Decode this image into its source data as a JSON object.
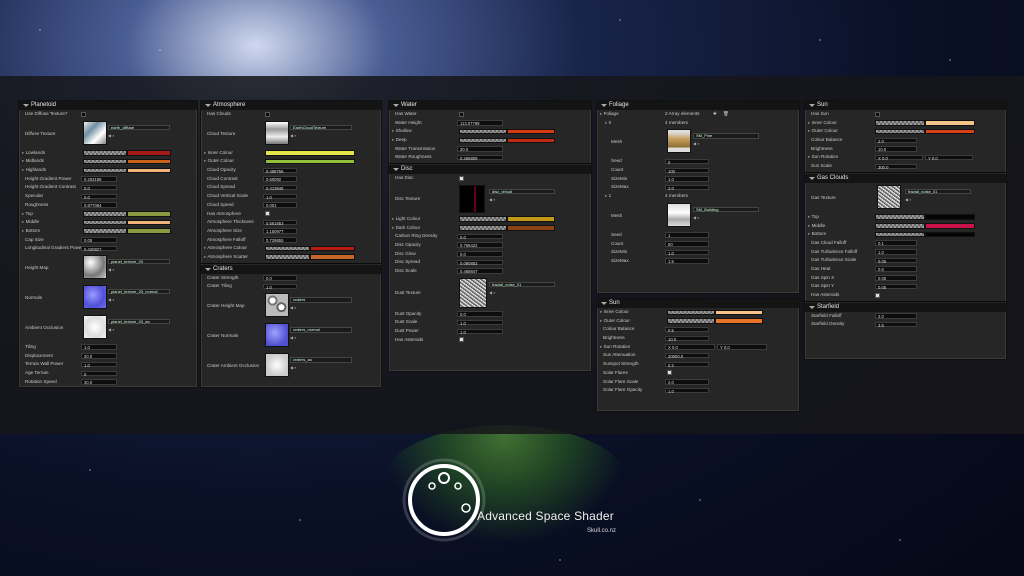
{
  "brand": {
    "title": "Advanced Space Shader",
    "site": "Skull.co.nz"
  },
  "colors": {
    "red": "#a41818",
    "orange": "#c8601a",
    "peach": "#f0b27a",
    "yellow": "#e6e34a",
    "green": "#8fc23a",
    "olive": "#8a9a40",
    "sunpeach": "#f5c28a",
    "sunorange": "#e8742a",
    "magenta": "#c8104a",
    "black": "#050505",
    "darkorange": "#c4682a",
    "darkred": "#b81c10",
    "gold": "#c29a18",
    "brown": "#8a4414",
    "bronze": "#b88a2a"
  },
  "planetoid": {
    "title": "Planetoid",
    "has_diffuse": "Use Diffuse Texture?",
    "diffuse_label": "Diffuse Texture",
    "diffuse_asset": "earth_diffuse",
    "lowlands": "Lowlands",
    "midlands": "Midlands",
    "highlands": "Highlands",
    "hg_power": "Height Gradient Power",
    "hg_power_v": "0.263186",
    "hg_contrast": "Height Gradient Contrast",
    "hg_contrast_v": "0.0",
    "specular": "Specular",
    "specular_v": "0.0",
    "roughness": "Roughness",
    "roughness_v": "0.877064",
    "top": "Top",
    "middle": "Middle",
    "bottom": "Bottom",
    "cap_size": "Cap Size",
    "cap_size_v": "0.05",
    "long_power": "Longitudinal Gradient Power",
    "long_power_v": "0.420827",
    "height_map": "Height Map",
    "height_asset": "planet_texture_03",
    "normals": "Normals",
    "normals_asset": "planet_texture_03_normal",
    "ao": "Ambient Occlusion",
    "ao_asset": "planet_texture_03_ao",
    "tiling": "Tiling",
    "tiling_v": "1.0",
    "displacement": "Displacement",
    "displacement_v": "20.0",
    "terrain_wall": "Terrain Wall Power",
    "terrain_wall_v": "1.0",
    "age_terrain": "Age Terrain",
    "age_terrain_v": "0",
    "rotation": "Rotation Speed",
    "rotation_v": "30.0"
  },
  "atmosphere": {
    "title": "Atmosphere",
    "has_clouds": "Has Clouds",
    "cloud_tex": "Cloud Texture",
    "cloud_asset": "EarthCloudTexture",
    "inner": "Inner Colour",
    "outer": "Outer Colour",
    "c_opacity": "Cloud Opacity",
    "c_opacity_v": "0.498756",
    "c_contrast": "Cloud Contrast",
    "c_contrast_v": "0.60092",
    "c_spread": "Cloud Spread",
    "c_spread_v": "0.413846",
    "c_vscale": "Cloud Vertical Scale",
    "c_vscale_v": "1.0",
    "c_speed": "Cloud Speed",
    "c_speed_v": "0.001",
    "has_atmo": "Has Atmosphere",
    "a_thick": "Atmosphere Thickness",
    "a_thick_v": "0.561653",
    "a_size": "Atmosphere Size",
    "a_size_v": "1.150977",
    "a_falloff": "Atmosphere Falloff",
    "a_falloff_v": "0.729855",
    "a_colour": "Atmosphere Colour",
    "a_scatter": "Atmosphere Scatter"
  },
  "craters": {
    "title": "Craters",
    "strength": "Crater Strength",
    "strength_v": "0.0",
    "tiling": "Crater Tiling",
    "tiling_v": "1.0",
    "height": "Crater Height Map",
    "height_asset": "craters",
    "normals": "Crater Normals",
    "normals_asset": "craters_normal",
    "ao": "Crater Ambient Occlusion",
    "ao_asset": "craters_ao"
  },
  "water": {
    "title": "Water",
    "has_water": "Has Water",
    "height": "Water Height",
    "height_v": "113.07799",
    "shallow": "Shallow",
    "deep": "Deep",
    "trans": "Water Transmission",
    "trans_v": "20.0",
    "rough": "Water Roughness",
    "rough_v": "0.266809"
  },
  "disc": {
    "title": "Disc",
    "has_disc": "Has Disc",
    "tex": "Disc Texture",
    "tex_asset": "disc_virtual",
    "light": "Light Colour",
    "dark": "Dark Colour",
    "carbon": "Carbon Ring Density",
    "carbon_v": "0.0",
    "opacity": "Disc Opacity",
    "opacity_v": "0.756422",
    "glow": "Disc Glow",
    "glow_v": "0.0",
    "spread": "Disc Spread",
    "spread_v": "0.090883",
    "scale": "Disc Scale",
    "scale_v": "0.468847",
    "dust_tex": "Dust Texture",
    "dust_asset": "fractal_noise_01",
    "dust_op": "Dust Opacity",
    "dust_op_v": "0.0",
    "dust_scale": "Dust Scale",
    "dust_scale_v": "1.0",
    "dust_power": "Dust Power",
    "dust_power_v": "1.0",
    "asteroids": "Has Asteroids"
  },
  "foliage": {
    "title": "Foliage",
    "foliage": "Foliage",
    "count_v": "2 Array elements",
    "e0": "0",
    "e1": "1",
    "members": "4 members",
    "mesh": "Mesh",
    "mesh0": "SM_Pine",
    "mesh1": "SM_Building",
    "seed": "Seed",
    "count": "Count",
    "sizemin": "SizeMin",
    "sizemax": "SizeMax",
    "s0": "0",
    "c0": "100",
    "mn0": "1.0",
    "mx0": "2.0",
    "s1": "1",
    "c1": "50",
    "mn1": "1.0",
    "mx1": "1.5"
  },
  "sun_mid": {
    "title": "Sun",
    "inner": "Inner Colour",
    "outer": "Outer Colour",
    "balance": "Colour Balance",
    "balance_v": "0.5",
    "brightness": "Brightness",
    "brightness_v": "10.0",
    "rotation": "Sun Rotation",
    "rx": "X 0.0",
    "ry": "Y 0.0",
    "atten": "Sun Attenuation",
    "atten_v": "20000.0",
    "sunspot": "Sunspot Strength",
    "sunspot_v": "0.2",
    "flares": "Solar Flares",
    "flare_scale": "Solar Flare Scale",
    "flare_scale_v": "2.0",
    "flare_opacity": "Solar Flare Opacity",
    "flare_opacity_v": "1.0"
  },
  "sun_right": {
    "title": "Sun",
    "has_sun": "Has Sun",
    "inner": "Inner Colour",
    "outer": "Outer Colour",
    "balance": "Colour Balance",
    "balance_v": "2.0",
    "brightness": "Brightness",
    "brightness_v": "10.0",
    "rotation": "Sun Rotation",
    "rx": "X 0.0",
    "ry": "Y 0.0",
    "scale": "Sun Scale",
    "scale_v": "300.0"
  },
  "gas": {
    "title": "Gas Clouds",
    "tex": "Gas Texture",
    "tex_asset": "fractal_noise_01",
    "top": "Top",
    "middle": "Middle",
    "bottom": "Bottom",
    "falloff": "Gas Cloud Falloff",
    "falloff_v": "0.1",
    "turb_falloff": "Gas Turbulence Falloff",
    "turb_falloff_v": "1.0",
    "turb_scale": "Gas Turbulence Scale",
    "turb_scale_v": "0.05",
    "heat": "Gas Heat",
    "heat_v": "0.5",
    "spinx": "Gas Spin X",
    "spinx_v": "0.05",
    "spiny": "Gas Spin Y",
    "spiny_v": "0.05",
    "asteroids": "Has Asteroids"
  },
  "starfield": {
    "title": "Starfield",
    "falloff": "Starfield Falloff",
    "falloff_v": "2.0",
    "density": "Starfield Density",
    "density_v": "3.5"
  }
}
